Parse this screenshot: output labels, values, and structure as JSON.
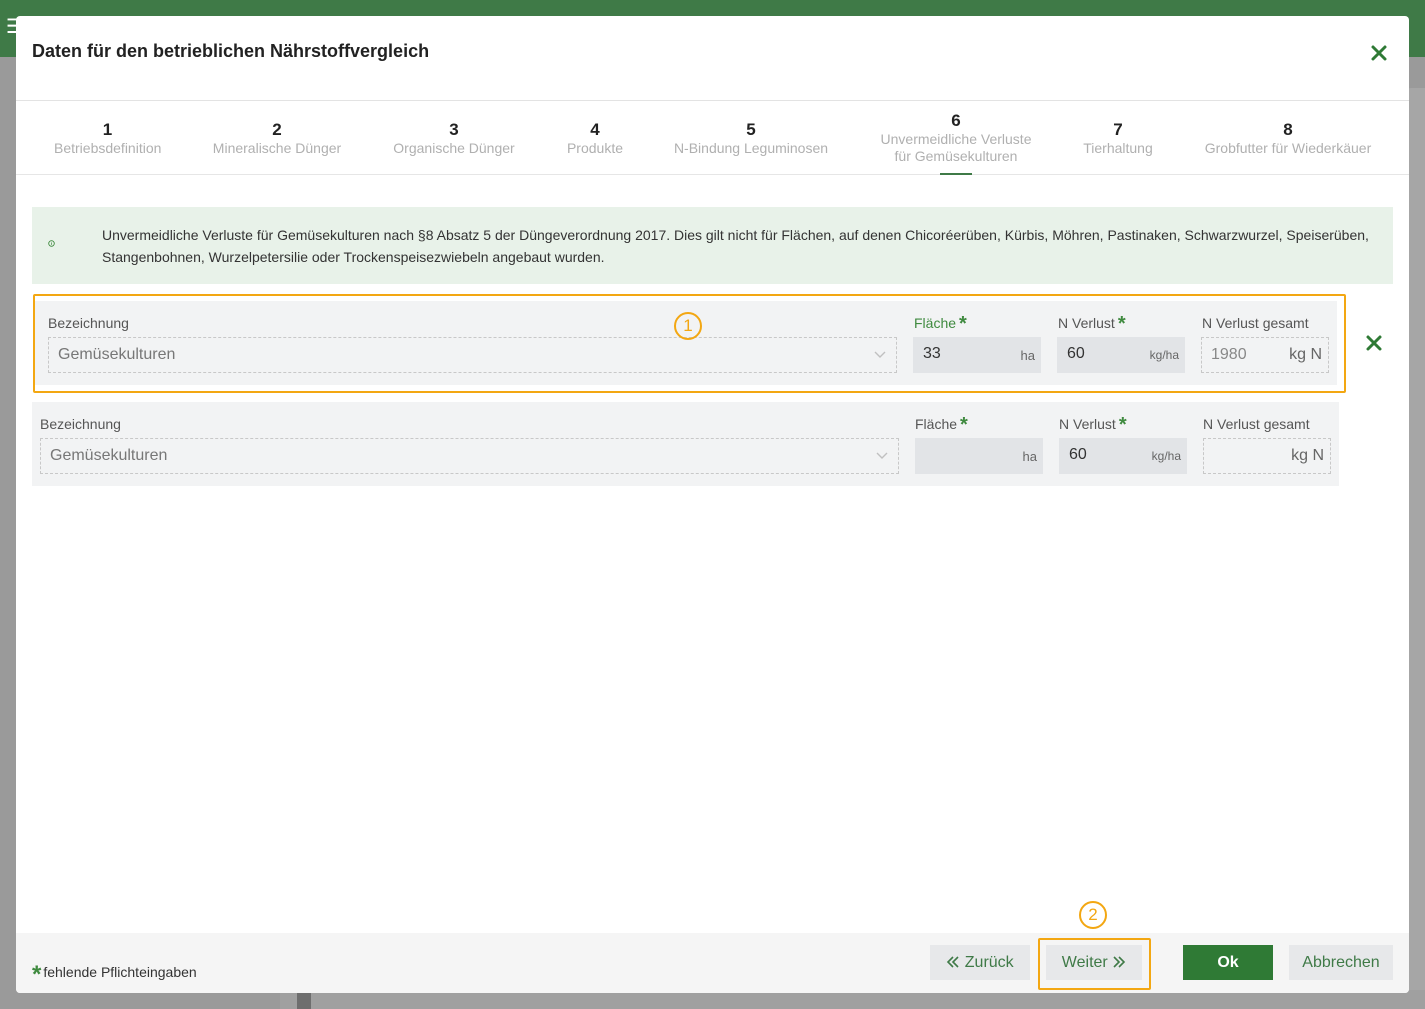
{
  "modal": {
    "title": "Daten für den betrieblichen Nährstoffvergleich"
  },
  "steps": [
    {
      "num": "1",
      "label": "Betriebsdefinition"
    },
    {
      "num": "2",
      "label": "Mineralische Dünger"
    },
    {
      "num": "3",
      "label": "Organische Dünger"
    },
    {
      "num": "4",
      "label": "Produkte"
    },
    {
      "num": "5",
      "label": "N-Bindung Leguminosen"
    },
    {
      "num": "6",
      "label": "Unvermeidliche Verluste",
      "label2": "für Gemüsekulturen"
    },
    {
      "num": "7",
      "label": "Tierhaltung"
    },
    {
      "num": "8",
      "label": "Grobfutter für Wiederkäuer"
    }
  ],
  "active_step": 6,
  "info": {
    "text": "Unvermeidliche Verluste für Gemüsekulturen nach §8 Absatz 5 der Düngeverordnung 2017. Dies gilt nicht für Flächen, auf denen Chicoréerüben, Kürbis, Möhren, Pastinaken, Schwarzwurzel, Speiserüben, Stangenbohnen, Wurzelpetersilie oder Trockenspeisezwiebeln angebaut wurden."
  },
  "labels": {
    "bezeichnung": "Bezeichnung",
    "flaeche": "Fläche",
    "n_verlust": "N Verlust",
    "n_verlust_gesamt": "N Verlust gesamt",
    "required_mark": "*"
  },
  "rows": [
    {
      "bezeichnung": "Gemüsekulturen",
      "flaeche": "33",
      "flaeche_unit": "ha",
      "n_verlust": "60",
      "n_verlust_unit": "kg/ha",
      "gesamt": "1980",
      "gesamt_unit": "kg N"
    },
    {
      "bezeichnung": "Gemüsekulturen",
      "flaeche": "",
      "flaeche_unit": "ha",
      "n_verlust": "60",
      "n_verlust_unit": "kg/ha",
      "gesamt": "",
      "gesamt_unit": "kg N"
    }
  ],
  "markers": [
    "1",
    "2"
  ],
  "footer": {
    "legend": "fehlende Pflichteingaben",
    "back_label": "Zurück",
    "next_label": "Weiter",
    "ok_label": "Ok",
    "cancel_label": "Abbrechen"
  },
  "colors": {
    "accent": "#3f7a47",
    "highlight": "#f3a712",
    "info_bg": "#e8f2e9"
  }
}
